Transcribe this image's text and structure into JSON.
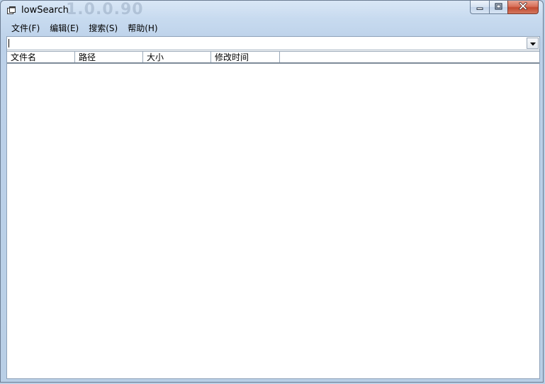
{
  "window": {
    "title": "lowSearch",
    "ghost_text": "1.0.0.90"
  },
  "menu": {
    "items": [
      {
        "label": "文件(F)"
      },
      {
        "label": "编辑(E)"
      },
      {
        "label": "搜索(S)"
      },
      {
        "label": "帮助(H)"
      }
    ]
  },
  "search": {
    "value": "",
    "placeholder": ""
  },
  "table": {
    "columns": [
      {
        "label": "文件名"
      },
      {
        "label": "路径"
      },
      {
        "label": "大小"
      },
      {
        "label": "修改时间"
      }
    ],
    "rows": []
  },
  "colors": {
    "frame": "#b9cfe6",
    "close_button": "#c24a30",
    "client_bg": "#ffffff"
  },
  "icons": {
    "app": "app-window-icon",
    "minimize": "minimize-icon",
    "maximize": "maximize-icon",
    "close": "close-icon",
    "dropdown": "chevron-down-icon"
  }
}
